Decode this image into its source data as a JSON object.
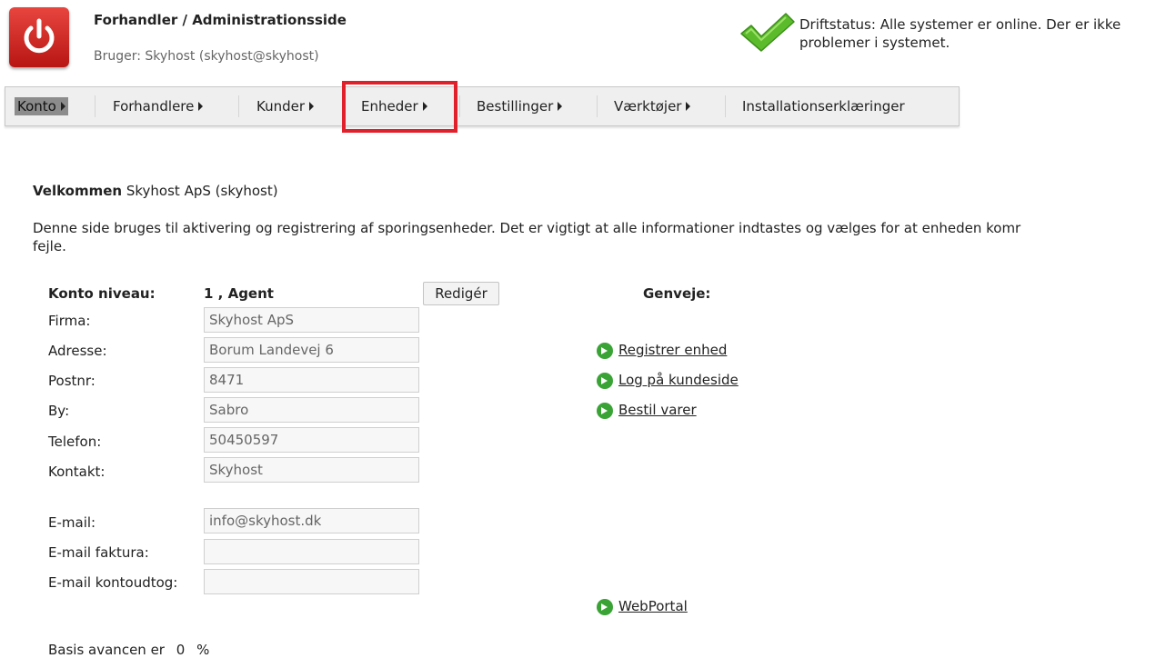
{
  "header": {
    "title": "Forhandler / Administrationsside",
    "user": "Bruger: Skyhost (skyhost@skyhost)",
    "status_line1": "Driftstatus: Alle systemer er online. Der er ikke",
    "status_line2": "problemer i systemet."
  },
  "nav": {
    "items": [
      {
        "label": "Konto"
      },
      {
        "label": "Forhandlere"
      },
      {
        "label": "Kunder"
      },
      {
        "label": "Enheder"
      },
      {
        "label": "Bestillinger"
      },
      {
        "label": "Værktøjer"
      },
      {
        "label": "Installationserklæringer"
      }
    ],
    "highlight_color": "#e0202a"
  },
  "welcome": {
    "bold": "Velkommen",
    "name": "Skyhost ApS (skyhost)"
  },
  "intro": {
    "line1": "Denne side bruges til aktivering og registrering af sporingsenheder. Det er vigtigt at alle informationer indtastes og vælges for at enheden komr",
    "line2": "fejle."
  },
  "account": {
    "level_label": "Konto niveau:",
    "level_value": "1 , Agent",
    "edit_button": "Redigér",
    "fields": {
      "firma": {
        "label": "Firma:",
        "value": "Skyhost ApS"
      },
      "adresse": {
        "label": "Adresse:",
        "value": "Borum Landevej 6"
      },
      "postnr": {
        "label": "Postnr:",
        "value": "8471"
      },
      "by": {
        "label": "By:",
        "value": "Sabro"
      },
      "telefon": {
        "label": "Telefon:",
        "value": "50450597"
      },
      "kontakt": {
        "label": "Kontakt:",
        "value": "Skyhost"
      },
      "email": {
        "label": "E-mail:",
        "value": "info@skyhost.dk"
      },
      "email_faktura": {
        "label": "E-mail faktura:",
        "value": ""
      },
      "email_kontoudtog": {
        "label": "E-mail kontoudtog:",
        "value": ""
      }
    }
  },
  "shortcuts": {
    "title": "Genveje:",
    "links": [
      {
        "label": "Registrer enhed"
      },
      {
        "label": "Log på kundeside"
      },
      {
        "label": "Bestil varer"
      },
      {
        "label": "WebPortal"
      }
    ],
    "icon_color": "#3aa335"
  },
  "basis": {
    "label": "Basis avancen er",
    "value": "0",
    "unit": "%"
  }
}
